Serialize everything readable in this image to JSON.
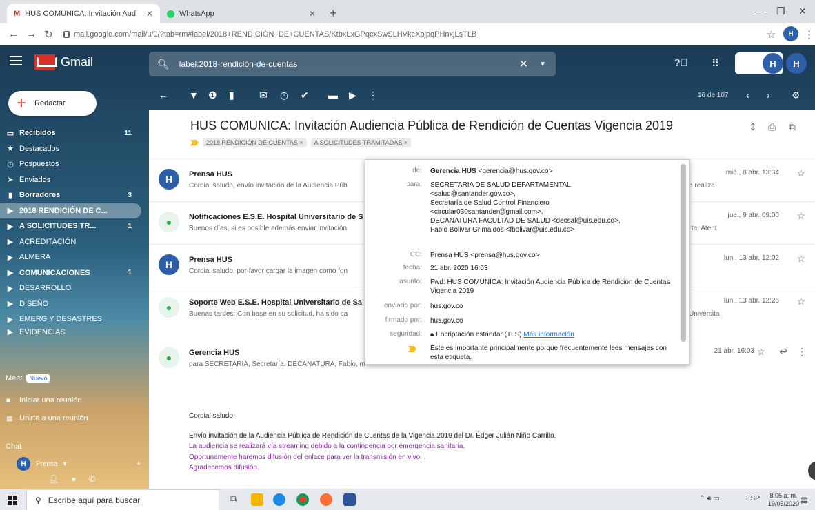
{
  "browser": {
    "tabs": [
      {
        "title": "HUS COMUNICA: Invitación Aud",
        "active": true
      },
      {
        "title": "WhatsApp",
        "active": false
      }
    ],
    "url": "mail.google.com/mail/u/0/?tab=rm#label/2018+RENDICIÓN+DE+CUENTAS/KtbxLxGPqcxSwSLHVkcXpjpqPHnxjLsTLB"
  },
  "gmail": {
    "app_name": "Gmail",
    "search": {
      "value": "label:2018-rendición-de-cuentas"
    },
    "compose_label": "Redactar",
    "pager": "16 de 107"
  },
  "sidebar": {
    "items": [
      {
        "label": "Recibidos",
        "count": "11",
        "bold": true,
        "icon": "inbox-icon"
      },
      {
        "label": "Destacados",
        "count": "",
        "bold": false,
        "icon": "star-icon"
      },
      {
        "label": "Pospuestos",
        "count": "",
        "bold": false,
        "icon": "clock-icon"
      },
      {
        "label": "Enviados",
        "count": "",
        "bold": false,
        "icon": "send-icon"
      },
      {
        "label": "Borradores",
        "count": "3",
        "bold": true,
        "icon": "draft-icon"
      },
      {
        "label": "2018 RENDICIÓN DE C...",
        "count": "",
        "bold": true,
        "icon": "label-icon",
        "selected": true
      },
      {
        "label": "A SOLICITUDES TR...",
        "count": "1",
        "bold": true,
        "icon": "label-icon"
      },
      {
        "label": "ACREDITACIÓN",
        "count": "",
        "bold": false,
        "icon": "label-icon"
      },
      {
        "label": "ALMERA",
        "count": "",
        "bold": false,
        "icon": "label-icon"
      },
      {
        "label": "COMUNICACIONES",
        "count": "1",
        "bold": true,
        "icon": "label-icon"
      },
      {
        "label": "DESARROLLO",
        "count": "",
        "bold": false,
        "icon": "label-icon"
      },
      {
        "label": "DISEÑO",
        "count": "",
        "bold": false,
        "icon": "label-icon"
      },
      {
        "label": "EMERG Y DESASTRES",
        "count": "",
        "bold": false,
        "icon": "label-icon"
      },
      {
        "label": "EVIDENCIAS",
        "count": "",
        "bold": false,
        "icon": "label-icon"
      }
    ],
    "meet": {
      "title": "Meet",
      "badge": "Nuevo",
      "items": [
        "Iniciar una reunión",
        "Unirte a una reunión"
      ]
    },
    "chat": {
      "title": "Chat",
      "user": "Prensa"
    }
  },
  "thread": {
    "subject": "HUS COMUNICA: Invitación Audiencia Pública de Rendición de Cuentas Vigencia 2019",
    "labels": [
      "2018 RENDICIÓN DE CUENTAS ×",
      "A SOLICITUDES TRAMITADAS ×"
    ],
    "messages": [
      {
        "from": "Prensa HUS",
        "snippet": "Cordial saludo, envío invitación de la Audiencia Púb",
        "snippet_right": "se realiza",
        "date": "mié., 8 abr. 13:34",
        "avatar": "logo"
      },
      {
        "from": "Notificaciones E.S.E. Hospital Universitario de S",
        "snippet": "Buenos días, si es posible además enviar invitación",
        "snippet_right": "erta. Atent",
        "date": "jue., 9 abr. 09:00",
        "avatar": "generic"
      },
      {
        "from": "Prensa HUS",
        "snippet": "Cordial saludo, por favor cargar la imagen como fon",
        "snippet_right": "",
        "date": "lun., 13 abr. 12:02",
        "avatar": "logo"
      },
      {
        "from": "Soporte Web E.S.E. Hospital Universitario de Sa",
        "snippet": "Buenas tardes: Con base en su solicitud, ha sido ca",
        "snippet_right": "l Universita",
        "date": "lun., 13 abr. 12:26",
        "avatar": "generic"
      },
      {
        "from": "Gerencia HUS",
        "snippet": "para SECRETARIA, Secretaría, DECANATURA, Fabio, mí ▾",
        "snippet_right": "",
        "date": "21 abr. 16:03",
        "avatar": "generic"
      }
    ],
    "body": [
      "Cordial saludo,",
      "Envío invitación de la Audiencia Pública de Rendición de Cuentas de la Vigencia 2019 del Dr. Édger Julián Niño Carrillo.",
      "La audiencia se realizará vía streaming debido a la contingencia por emergencia sanitaria.",
      "Oportunamente haremos difusión del enlace para ver la transmisión en vivo.",
      "Agradecemos difusión."
    ]
  },
  "details": {
    "de_label": "de:",
    "de_name": "Gerencia HUS",
    "de_email": "<gerencia@hus.gov.co>",
    "para_label": "para:",
    "para_lines": [
      "SECRETARIA DE SALUD DEPARTAMENTAL",
      "<salud@santander.gov.co>,",
      "Secretaría de Salud Control Financiero",
      "<circular030santander@gmail.com>,",
      "DECANATURA FACULTAD DE SALUD <decsal@uis.edu.co>,",
      "Fabio Bolivar Grimaldos <fbolivar@uis.edu.co>"
    ],
    "cc_label": "CC:",
    "cc": "Prensa HUS <prensa@hus.gov.co>",
    "fecha_label": "fecha:",
    "fecha": "21 abr. 2020 16:03",
    "asunto_label": "asunto:",
    "asunto": "Fwd: HUS COMUNICA: Invitación Audiencia Pública de Rendición de Cuentas Vigencia 2019",
    "enviado_label": "enviado por:",
    "enviado": "hus.gov.co",
    "firmado_label": "firmado por:",
    "firmado": "hus.gov.co",
    "seguridad_label": "seguridad:",
    "seguridad": "Encriptación estándar (TLS)",
    "mas_info": "Más información",
    "importance": "Este es importante principalmente porque frecuentemente lees mensajes con esta etiqueta."
  },
  "taskbar": {
    "search_placeholder": "Escribe aquí para buscar",
    "lang": "ESP",
    "time": "8:05 a. m.",
    "date": "19/05/2020"
  }
}
